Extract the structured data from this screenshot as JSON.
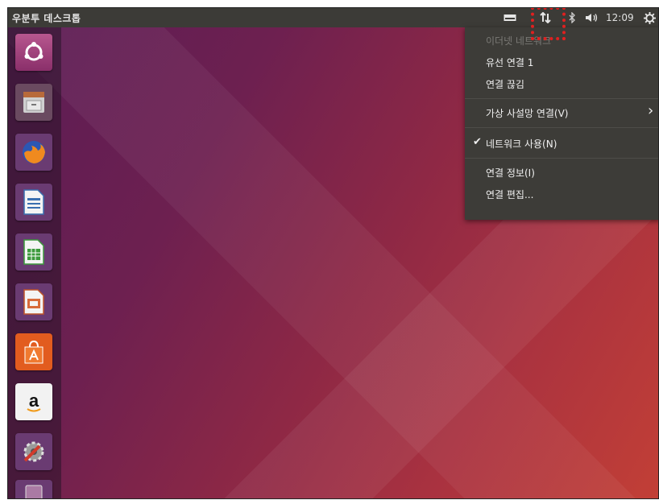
{
  "topbar": {
    "title": "우분투 데스크톱",
    "clock": "12:09",
    "icons": [
      "keyboard-icon",
      "network-updown-icon",
      "bluetooth-icon",
      "volume-icon",
      "gear-icon"
    ]
  },
  "launcher": {
    "items": [
      "ubuntu-dash",
      "files",
      "firefox",
      "writer",
      "calc",
      "impress",
      "software-center",
      "amazon",
      "system-settings",
      "trash"
    ]
  },
  "network_menu": {
    "header": "이더넷 네트워크",
    "wired": "유선 연결 1",
    "disconnect": "연결 끊김",
    "vpn": "가상 사설망 연결(V)",
    "vpn_arrow": "›",
    "enable_check": "✔",
    "enable": "네트워크 사용(N)",
    "info": "연결 정보(I)",
    "edit": "연결 편집..."
  },
  "colors": {
    "highlight": "#e02020",
    "topbar": "#3c3b37",
    "menu": "#3d3c38"
  }
}
